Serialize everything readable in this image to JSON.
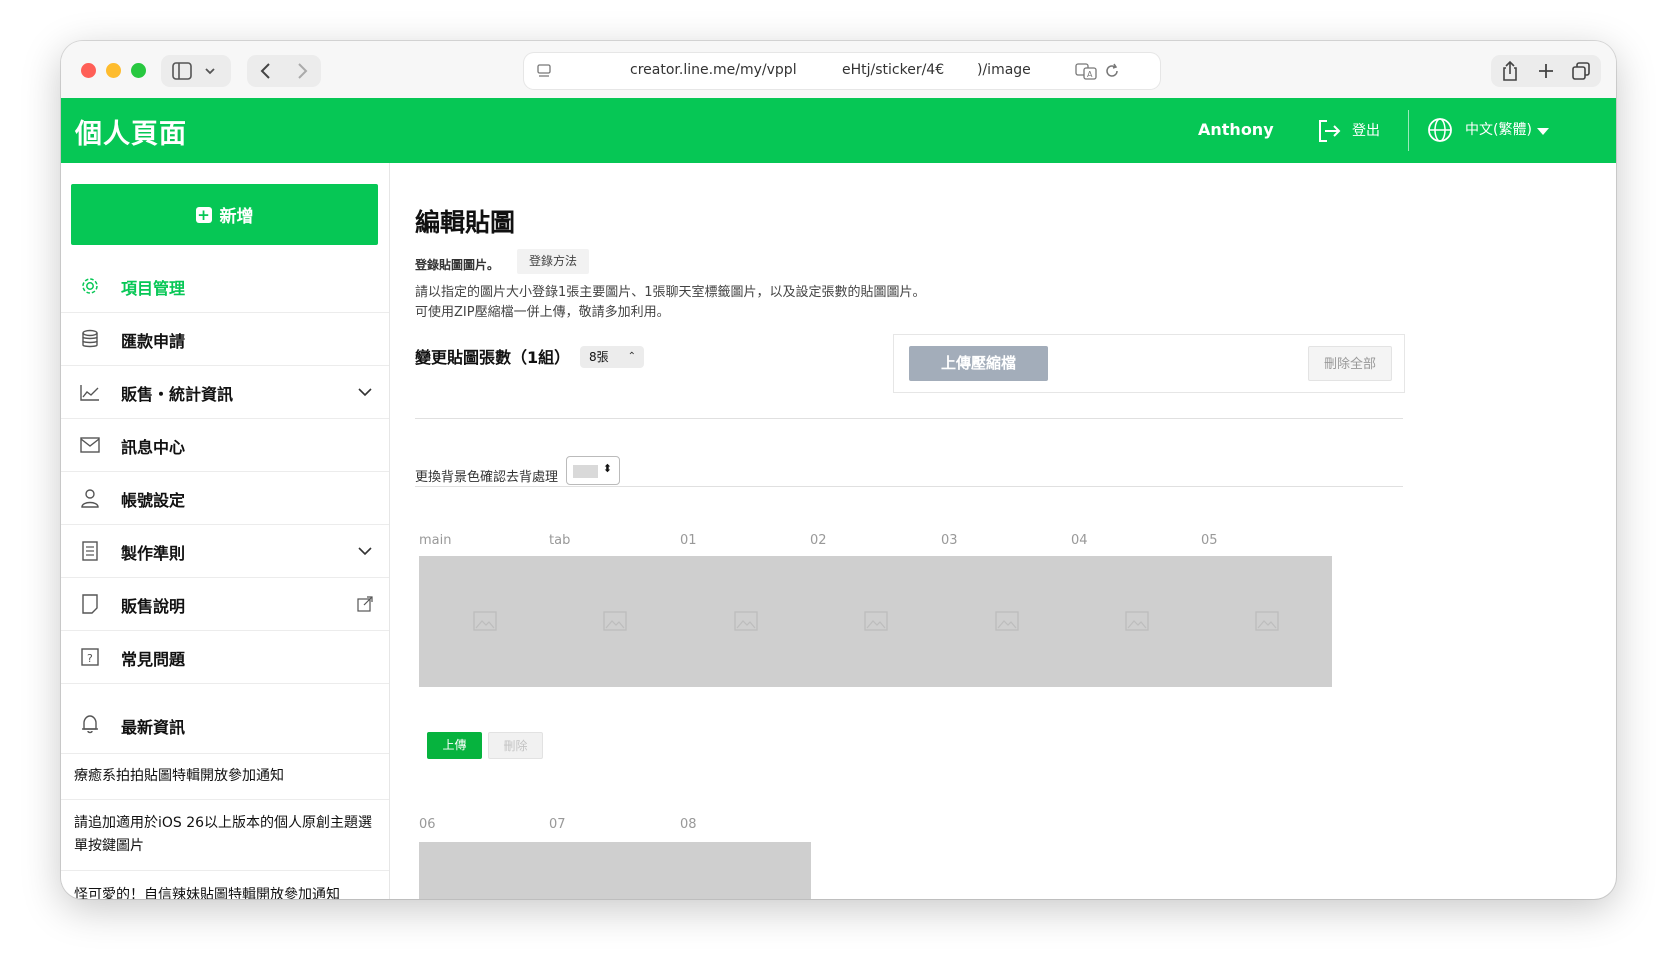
{
  "browser": {
    "url_parts": [
      "creator.line.me/my/vppl",
      "eHtj/sticker/4€",
      ")/image"
    ]
  },
  "header": {
    "brand": "個人頁面",
    "username": "Anthony",
    "logout_label": "登出",
    "language": "中文(繁體)",
    "accent_color": "#06c755"
  },
  "sidebar": {
    "add_button": "新增",
    "items": [
      {
        "label": "項目管理",
        "icon": "gear-icon",
        "active": true
      },
      {
        "label": "匯款申請",
        "icon": "database-icon"
      },
      {
        "label": "販售・統計資訊",
        "icon": "chart-icon",
        "expandable": true
      },
      {
        "label": "訊息中心",
        "icon": "mail-icon"
      },
      {
        "label": "帳號設定",
        "icon": "user-icon"
      },
      {
        "label": "製作準則",
        "icon": "document-icon",
        "expandable": true
      },
      {
        "label": "販售說明",
        "icon": "page-icon",
        "external": true
      },
      {
        "label": "常見問題",
        "icon": "question-icon"
      },
      {
        "label": "最新資訊",
        "icon": "bell-icon"
      }
    ],
    "news": [
      "療癒系拍拍貼圖特輯開放參加通知",
      "請追加適用於iOS 26以上版本的個人原創主題選單按鍵圖片",
      "怪可愛的！自信辣妹貼圖特輯開放參加通知"
    ]
  },
  "main": {
    "title": "編輯貼圖",
    "register_label": "登錄貼圖圖片。",
    "howto_button": "登錄方法",
    "desc_line1": "請以指定的圖片大小登錄1張主要圖片、1張聊天室標籤圖片，以及設定張數的貼圖圖片。",
    "desc_line2": "可使用ZIP壓縮檔一併上傳，敬請多加利用。",
    "count_label": "變更貼圖張數（1組）",
    "count_value": "8張",
    "upload_zip_button": "上傳壓縮檔",
    "delete_all_button": "刪除全部",
    "bg_label": "更換背景色確認去背處理",
    "tiles_row1": [
      "main",
      "tab",
      "01",
      "02",
      "03",
      "04",
      "05"
    ],
    "tiles_row2": [
      "06",
      "07",
      "08"
    ],
    "upload_button": "上傳",
    "delete_button": "刪除"
  }
}
